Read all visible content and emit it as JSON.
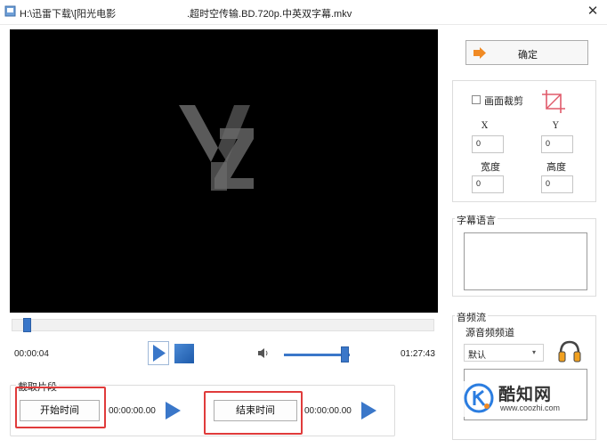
{
  "window": {
    "title_left": "H:\\迅雷下载\\[阳光电影",
    "title_right": ".超时空传输.BD.720p.中英双字幕.mkv",
    "close_glyph": "✕"
  },
  "player": {
    "current_time": "00:00:04",
    "total_time": "01:27:43",
    "seek_progress": 0.02,
    "volume_level": 0.92
  },
  "clip": {
    "legend": "截取片段",
    "start_button": "开始时间",
    "start_time": "00:00:00.00",
    "end_button": "结束时间",
    "end_time": "00:00:00.00"
  },
  "panel": {
    "confirm_button": "确定",
    "crop_label": "画面裁剪",
    "crop_checked": false,
    "x_label": "X",
    "y_label": "Y",
    "x_value": "0",
    "y_value": "0",
    "width_label": "宽度",
    "height_label": "高度",
    "width_value": "0",
    "height_value": "0",
    "subtitle_legend": "字幕语言",
    "audio_legend": "音频流",
    "audio_source_label": "源音频频道",
    "audio_selected": "默认"
  },
  "site": {
    "name": "酷知网",
    "url": "www.coozhi.com"
  },
  "colors": {
    "accent_blue": "#3a77c9",
    "highlight_red": "#e03b3b",
    "video_bg": "#000000",
    "confirm_arrow": "#f08a24"
  }
}
